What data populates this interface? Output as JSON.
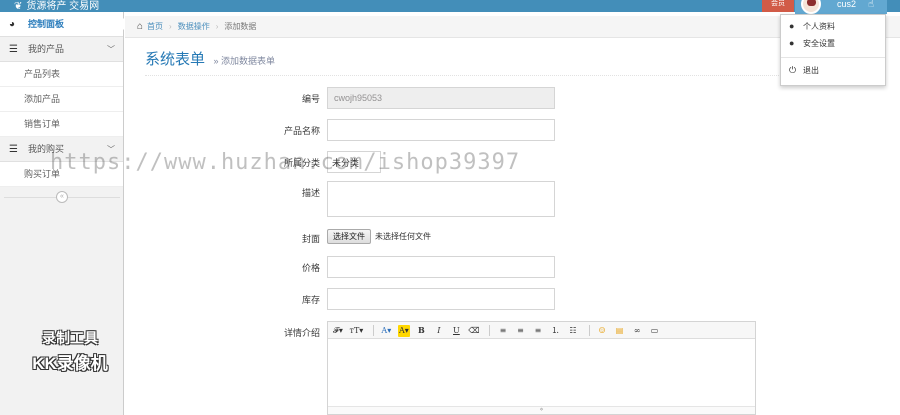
{
  "topbar": {
    "brand": "货源将产 交易网",
    "badge": "会员",
    "username": "cus2"
  },
  "user_menu": {
    "items": [
      {
        "icon": "user-icon",
        "glyph": "👤",
        "label": "个人资料"
      },
      {
        "icon": "shield-user-icon",
        "glyph": "👤",
        "label": "安全设置"
      },
      {
        "icon": "power-icon",
        "glyph": "⏻",
        "label": "退出"
      }
    ]
  },
  "sidebar": {
    "dashboard": "控制面板",
    "my_products": "我的产品",
    "product_list": "产品列表",
    "add_product": "添加产品",
    "sales_orders": "销售订单",
    "my_purchases": "我的购买",
    "purchase_orders": "购买订单"
  },
  "breadcrumb": {
    "home": "首页",
    "data_ops": "数据操作",
    "add_data": "添加数据"
  },
  "page": {
    "title": "系统表单",
    "subtitle": "添加数据表单"
  },
  "form": {
    "code_label": "编号",
    "code_value": "cwojh95053",
    "name_label": "产品名称",
    "category_label": "所属分类",
    "category_value": "未分类",
    "desc_label": "描述",
    "cover_label": "封面",
    "file_button": "选择文件",
    "file_status": "未选择任何文件",
    "price_label": "价格",
    "stock_label": "库存",
    "details_label": "详情介绍"
  },
  "overlay": {
    "watermark": "https://www.huzhan.com/ishop39397",
    "kk_line1": "录制工具",
    "kk_line2": "KK录像机"
  },
  "colors": {
    "topbar": "#438eb9",
    "accent": "#2679b5",
    "badge": "#d15b47"
  }
}
